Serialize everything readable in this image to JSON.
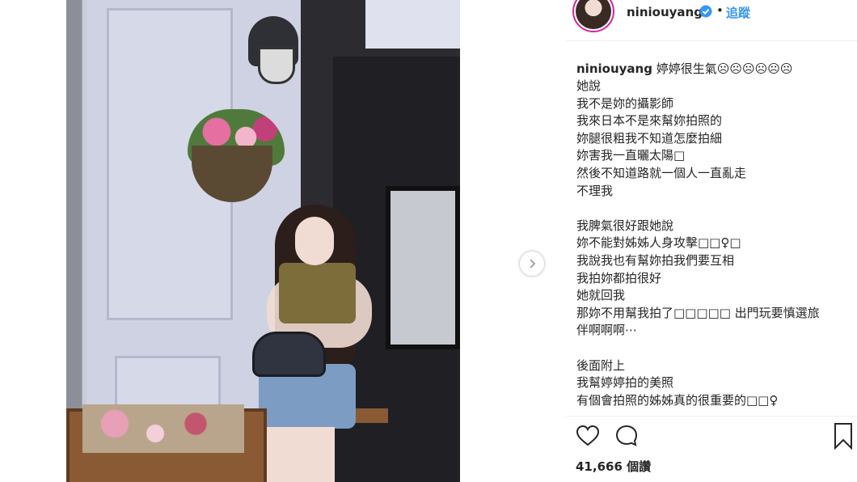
{
  "post": {
    "username": "niniouyang",
    "follow_label": "追蹤",
    "dot": "•",
    "caption_title": "婷婷很生氣☹☹☹☹☹☹",
    "caption_lines": [
      "她說",
      "我不是妳的攝影師",
      "我來日本不是來幫妳拍照的",
      "妳腿很粗我不知道怎麼拍細",
      "妳害我一直曬太陽□",
      "然後不知道路就一個人一直亂走",
      "不理我",
      "",
      "我脾氣很好跟她說",
      "妳不能對姊姊人身攻擊□□♀□",
      "我說我也有幫妳拍我們要互相",
      "我拍妳都拍很好",
      "她就回我",
      "那妳不用幫我拍了□□□□□ 出門玩要慎選旅",
      "伴啊啊啊⋯",
      "",
      "後面附上",
      "我幫婷婷拍的美照",
      "有個會拍照的姊姊真的很重要的□□♀"
    ],
    "views": "41,666 個讚"
  },
  "icons": {
    "verified": "verified-badge-icon",
    "next": "chevron-right-icon",
    "like": "heart-icon",
    "comment": "comment-bubble-icon",
    "save": "bookmark-icon"
  },
  "colors": {
    "link": "#3897f0",
    "verified": "#3897f0",
    "text": "#262626"
  }
}
